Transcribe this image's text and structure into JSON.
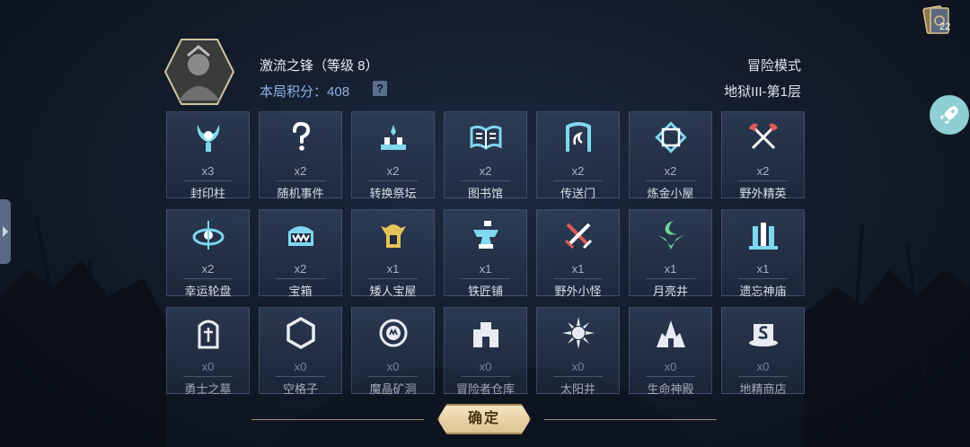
{
  "header": {
    "title": "激流之锋（等级 8）",
    "score_label": "本局积分：",
    "score_value": "408",
    "help_label": "?",
    "mode": "冒险模式",
    "floor": "地狱III-第1层"
  },
  "top_right": {
    "count": "22"
  },
  "cards": [
    {
      "name": "封印柱",
      "count": "x3",
      "icon": "seal-pillar-icon"
    },
    {
      "name": "随机事件",
      "count": "x2",
      "icon": "question-icon"
    },
    {
      "name": "转换祭坛",
      "count": "x2",
      "icon": "altar-icon"
    },
    {
      "name": "图书馆",
      "count": "x2",
      "icon": "book-icon"
    },
    {
      "name": "传送门",
      "count": "x2",
      "icon": "portal-icon"
    },
    {
      "name": "炼金小屋",
      "count": "x2",
      "icon": "alchemy-icon"
    },
    {
      "name": "野外精英",
      "count": "x2",
      "icon": "crossed-axes-icon"
    },
    {
      "name": "幸运轮盘",
      "count": "x2",
      "icon": "wheel-icon"
    },
    {
      "name": "宝箱",
      "count": "x2",
      "icon": "chest-icon"
    },
    {
      "name": "矮人宝屋",
      "count": "x1",
      "icon": "dwarf-helmet-icon"
    },
    {
      "name": "铁匠铺",
      "count": "x1",
      "icon": "anvil-icon"
    },
    {
      "name": "野外小怪",
      "count": "x1",
      "icon": "crossed-swords-icon"
    },
    {
      "name": "月亮井",
      "count": "x1",
      "icon": "moon-icon"
    },
    {
      "name": "遗忘神庙",
      "count": "x1",
      "icon": "temple-icon"
    },
    {
      "name": "勇士之墓",
      "count": "x0",
      "icon": "tomb-icon"
    },
    {
      "name": "空格子",
      "count": "x0",
      "icon": "hexagon-icon"
    },
    {
      "name": "魔晶矿洞",
      "count": "x0",
      "icon": "crystal-mine-icon"
    },
    {
      "name": "冒险者仓库",
      "count": "x0",
      "icon": "warehouse-icon"
    },
    {
      "name": "太阳井",
      "count": "x0",
      "icon": "sun-icon"
    },
    {
      "name": "生命神殿",
      "count": "x0",
      "icon": "life-temple-icon"
    },
    {
      "name": "地精商店",
      "count": "x0",
      "icon": "goblin-shop-icon"
    }
  ],
  "confirm_label": "确定",
  "colors": {
    "accent_blue": "#8db3e6",
    "icon_cyan": "#7fd7f0",
    "icon_red": "#e05a5a",
    "icon_gold": "#e6c25a",
    "icon_green": "#6fd69a",
    "button_gold": "#dcc392"
  }
}
